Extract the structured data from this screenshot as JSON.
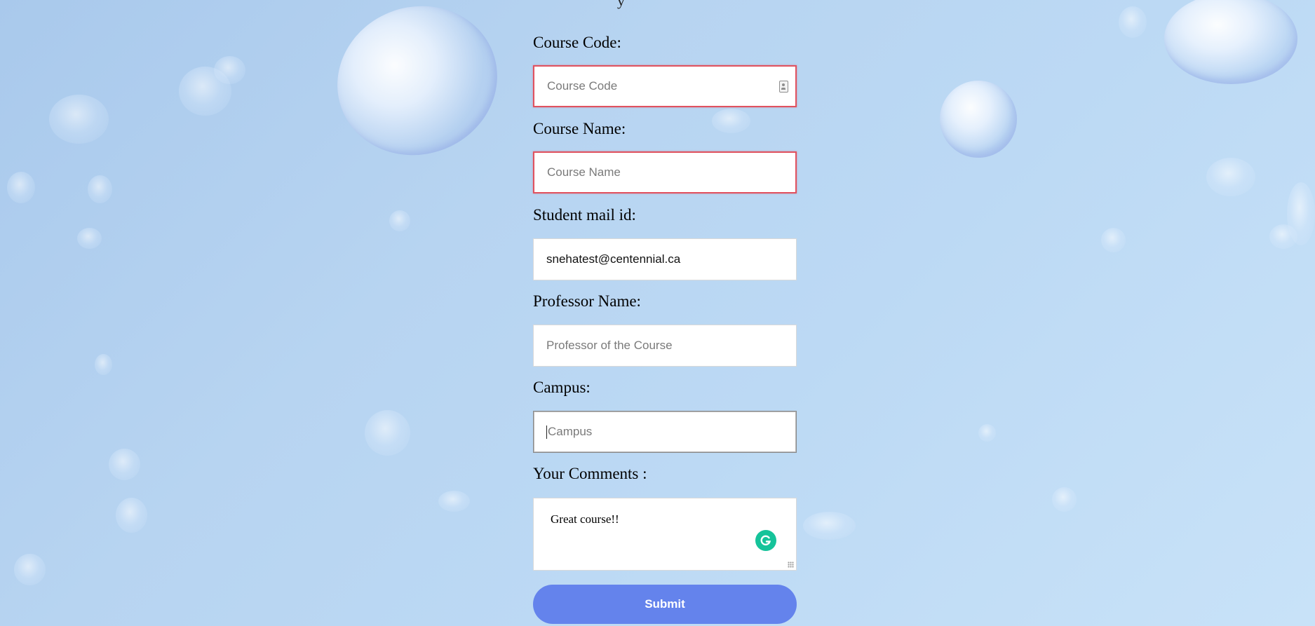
{
  "form": {
    "course_code": {
      "label": "Course Code:",
      "placeholder": "Course Code",
      "value": "",
      "state": "invalid"
    },
    "course_name": {
      "label": "Course Name:",
      "placeholder": "Course Name",
      "value": "",
      "state": "invalid"
    },
    "student_mail": {
      "label": "Student mail id:",
      "value": "snehatest@centennial.ca"
    },
    "professor_name": {
      "label": "Professor Name:",
      "placeholder": "Professor of the Course",
      "value": ""
    },
    "campus": {
      "label": "Campus:",
      "placeholder": "Campus",
      "value": "",
      "state": "focused"
    },
    "comments": {
      "label": "Your Comments :",
      "value": "Great course!!"
    },
    "submit_label": "Submit"
  },
  "colors": {
    "submit_button": "#6483ec",
    "invalid_border": "#e0525f",
    "grammarly_badge": "#15c39a"
  },
  "icons": {
    "course_code_field": "contact-card-icon",
    "comments_field": "grammarly-icon"
  }
}
